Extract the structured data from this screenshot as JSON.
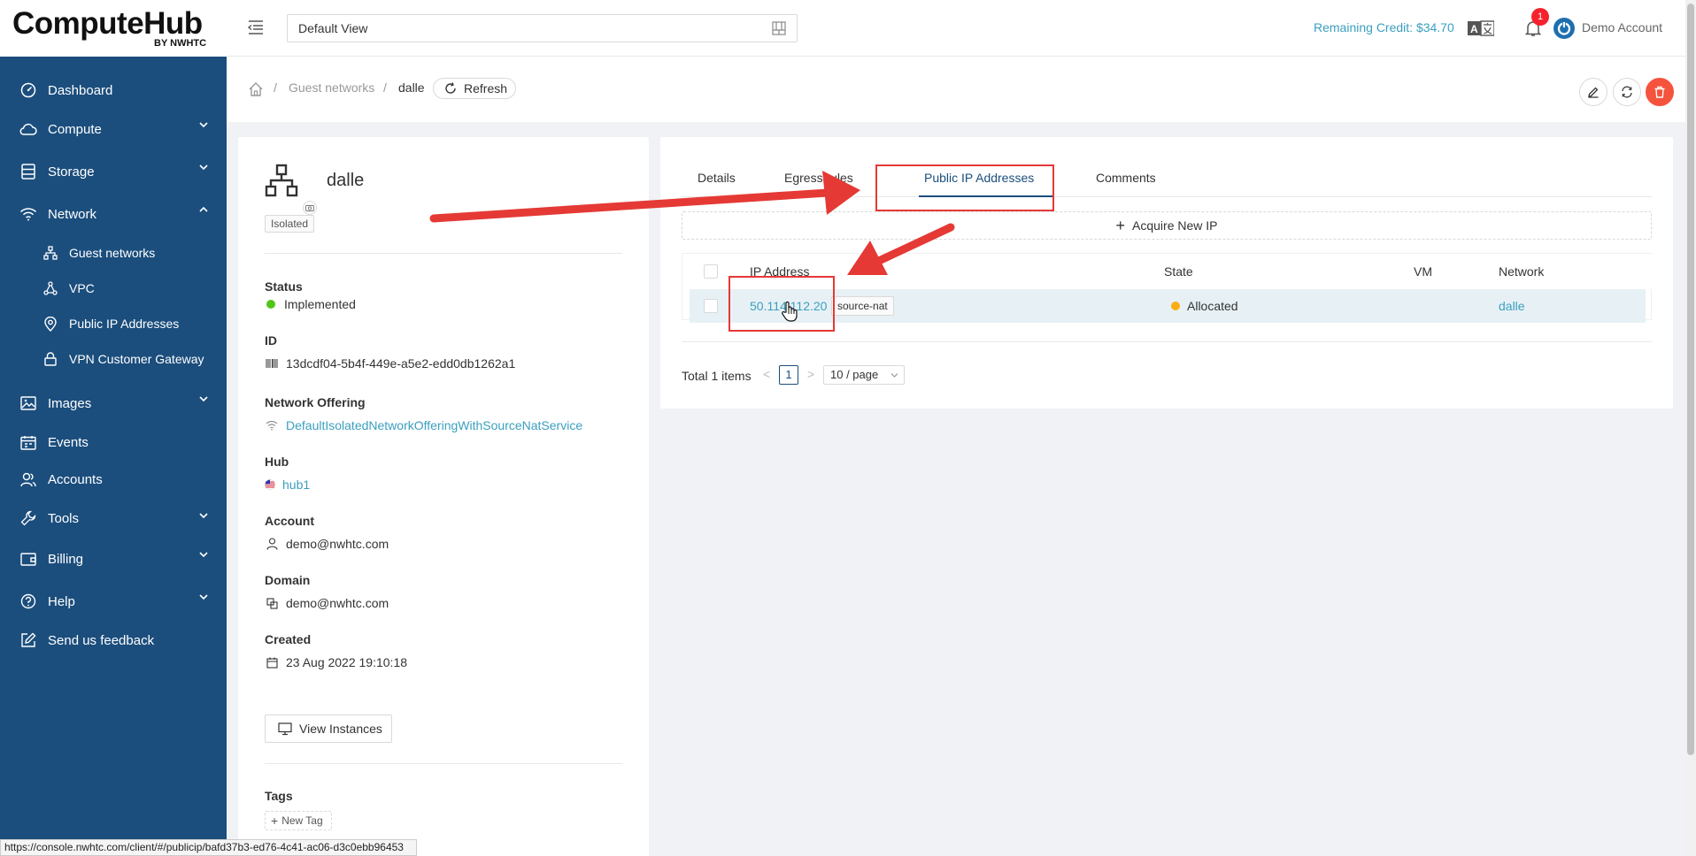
{
  "brand": {
    "name": "ComputeHub",
    "sub": "BY NWHTC"
  },
  "sidebar": {
    "items": [
      {
        "label": "Dashboard"
      },
      {
        "label": "Compute"
      },
      {
        "label": "Storage"
      },
      {
        "label": "Network"
      },
      {
        "label": "Guest networks"
      },
      {
        "label": "VPC"
      },
      {
        "label": "Public IP Addresses"
      },
      {
        "label": "VPN Customer Gateway"
      },
      {
        "label": "Images"
      },
      {
        "label": "Events"
      },
      {
        "label": "Accounts"
      },
      {
        "label": "Tools"
      },
      {
        "label": "Billing"
      },
      {
        "label": "Help"
      },
      {
        "label": "Send us feedback"
      }
    ]
  },
  "header": {
    "view": "Default View",
    "credit": "Remaining Credit: $34.70",
    "notifications": "1",
    "account": "Demo Account"
  },
  "breadcrumb": {
    "parent": "Guest networks",
    "current": "dalle",
    "refresh": "Refresh"
  },
  "network": {
    "name": "dalle",
    "type_tag": "Isolated",
    "fields": {
      "status_label": "Status",
      "status_value": "Implemented",
      "id_label": "ID",
      "id_value": "13dcdf04-5b4f-449e-a5e2-edd0db1262a1",
      "offering_label": "Network Offering",
      "offering_value": "DefaultIsolatedNetworkOfferingWithSourceNatService",
      "hub_label": "Hub",
      "hub_value": "hub1",
      "account_label": "Account",
      "account_value": "demo@nwhtc.com",
      "domain_label": "Domain",
      "domain_value": "demo@nwhtc.com",
      "created_label": "Created",
      "created_value": "23 Aug 2022 19:10:18"
    },
    "view_instances": "View Instances",
    "tags_label": "Tags",
    "new_tag": "New Tag"
  },
  "tabs": [
    "Details",
    "Egress rules",
    "Public IP Addresses",
    "Comments"
  ],
  "acquire": "Acquire New IP",
  "table": {
    "columns": [
      "IP Address",
      "State",
      "VM",
      "Network"
    ],
    "rows": [
      {
        "ip": "50.114.112.20",
        "tag": "source-nat",
        "state": "Allocated",
        "vm": "",
        "network": "dalle"
      }
    ]
  },
  "pager": {
    "total": "Total 1 items",
    "page": "1",
    "size": "10 / page",
    "prev": "<",
    "next": ">"
  },
  "status_url": "https://console.nwhtc.com/client/#/publicip/bafd37b3-ed76-4c41-ac06-d3c0ebb96453",
  "colors": {
    "sidebar": "#1b4e7d",
    "link": "#3a9fbf",
    "annotation": "#e53935",
    "danger": "#f5533d"
  }
}
